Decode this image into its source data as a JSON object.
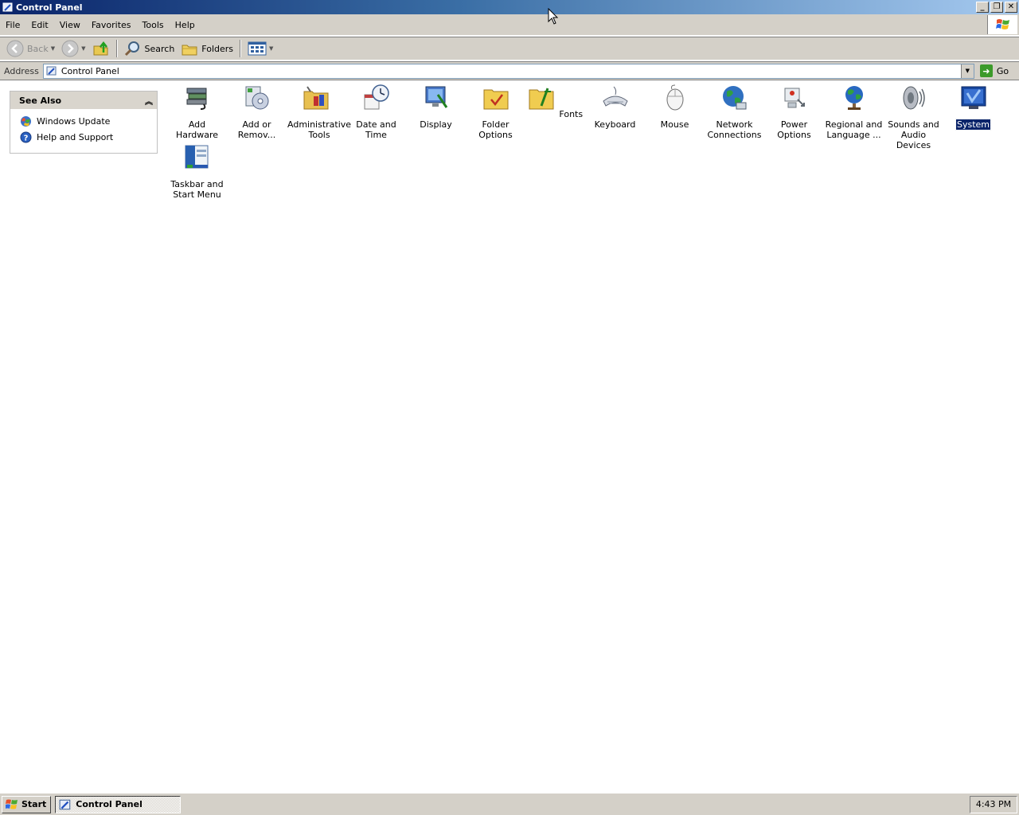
{
  "window": {
    "title": "Control Panel",
    "controls": {
      "minimize": "_",
      "restore": "❐",
      "close": "✕"
    }
  },
  "menubar": {
    "items": [
      "File",
      "Edit",
      "View",
      "Favorites",
      "Tools",
      "Help"
    ]
  },
  "toolbar": {
    "back_label": "Back",
    "search_label": "Search",
    "folders_label": "Folders"
  },
  "address": {
    "label": "Address",
    "value": "Control Panel",
    "go_label": "Go"
  },
  "see_also": {
    "title": "See Also",
    "links": [
      "Windows Update",
      "Help and Support"
    ]
  },
  "items": [
    {
      "label": "Add Hardware",
      "icon": "add-hardware-icon"
    },
    {
      "label": "Add or Remov...",
      "icon": "add-remove-programs-icon"
    },
    {
      "label": "Administrative Tools",
      "icon": "administrative-tools-icon"
    },
    {
      "label": "Date and Time",
      "icon": "date-time-icon"
    },
    {
      "label": "Display",
      "icon": "display-icon"
    },
    {
      "label": "Folder Options",
      "icon": "folder-options-icon"
    },
    {
      "label": "Fonts",
      "icon": "fonts-icon"
    },
    {
      "label": "Keyboard",
      "icon": "keyboard-icon"
    },
    {
      "label": "Mouse",
      "icon": "mouse-icon"
    },
    {
      "label": "Network Connections",
      "icon": "network-connections-icon"
    },
    {
      "label": "Power Options",
      "icon": "power-options-icon"
    },
    {
      "label": "Regional and Language ...",
      "icon": "regional-language-icon"
    },
    {
      "label": "Sounds and Audio Devices",
      "icon": "sounds-audio-icon"
    },
    {
      "label": "System",
      "icon": "system-icon",
      "selected": true
    },
    {
      "label": "Taskbar and Start Menu",
      "icon": "taskbar-start-menu-icon"
    }
  ],
  "taskbar": {
    "start_label": "Start",
    "task_label": "Control Panel",
    "clock": "4:43 PM"
  },
  "colors": {
    "selection": "#0a246a",
    "face": "#d4d0c8",
    "title_start": "#0a246a",
    "title_end": "#a6caf0"
  }
}
